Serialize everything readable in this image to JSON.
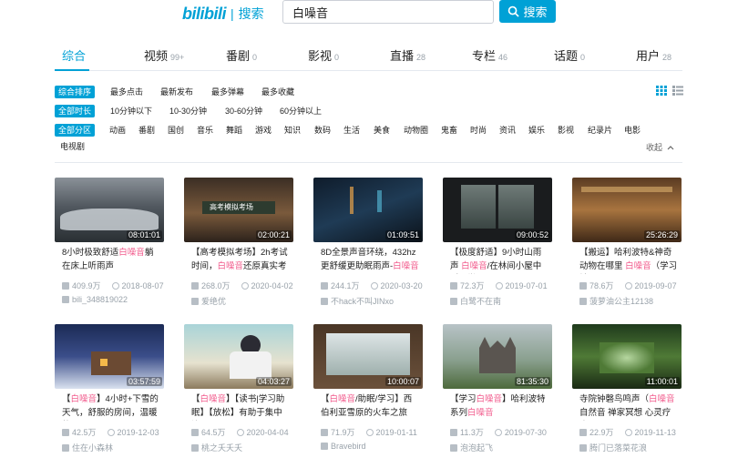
{
  "header": {
    "logo_mark": "bilibili",
    "logo_sep": "|",
    "logo_text": "搜索",
    "search_value": "白噪音",
    "search_button": "搜索"
  },
  "tabs": [
    {
      "label": "综合",
      "count": ""
    },
    {
      "label": "视频",
      "count": "99+"
    },
    {
      "label": "番剧",
      "count": "0"
    },
    {
      "label": "影视",
      "count": "0"
    },
    {
      "label": "直播",
      "count": "28"
    },
    {
      "label": "专栏",
      "count": "46"
    },
    {
      "label": "话题",
      "count": "0"
    },
    {
      "label": "用户",
      "count": "28"
    }
  ],
  "filters": {
    "order": [
      "综合排序",
      "最多点击",
      "最新发布",
      "最多弹幕",
      "最多收藏"
    ],
    "duration": [
      "全部时长",
      "10分钟以下",
      "10-30分钟",
      "30-60分钟",
      "60分钟以上"
    ],
    "zones": [
      "全部分区",
      "动画",
      "番剧",
      "国创",
      "音乐",
      "舞蹈",
      "游戏",
      "知识",
      "数码",
      "生活",
      "美食",
      "动物圈",
      "鬼畜",
      "时尚",
      "资讯",
      "娱乐",
      "影视",
      "纪录片",
      "电影",
      "电视剧"
    ],
    "collapse_label": "收起"
  },
  "videos": [
    {
      "duration": "08:01:01",
      "pre": "8小时极致舒适",
      "hl": "白噪音",
      "post": "躺在床上听雨声",
      "plays": "409.9万",
      "date": "2018-08-07",
      "uploader": "bili_348819022"
    },
    {
      "duration": "02:00:21",
      "pre": "【高考模拟考场】2h考试时间，",
      "hl": "白噪音",
      "post": "还原真实考场环",
      "plays": "268.0万",
      "date": "2020-04-02",
      "uploader": "爱绝优"
    },
    {
      "duration": "01:09:51",
      "pre": "8D全景声音环绕，432hz更舒缓更助眠雨声-",
      "hl": "白噪音",
      "post": "",
      "plays": "244.1万",
      "date": "2020-03-20",
      "uploader": "不hack不叫JINxo"
    },
    {
      "duration": "09:00:52",
      "pre": "【极度舒适】9小时山雨声 ",
      "hl": "白噪音",
      "post": "/在林间小屋中听雨学",
      "plays": "72.3万",
      "date": "2019-07-01",
      "uploader": "白鹭不在南"
    },
    {
      "duration": "25:26:29",
      "pre": "【搬运】哈利波特&神奇动物在哪里 ",
      "hl": "白噪音",
      "post": "（学习神",
      "plays": "78.6万",
      "date": "2019-09-07",
      "uploader": "菠萝油公主12138"
    },
    {
      "duration": "03:57:59",
      "pre": "【",
      "hl": "白噪音",
      "post": "】4小时+下雪的天气，舒服的房间，温暖的火",
      "plays": "42.5万",
      "date": "2019-12-03",
      "uploader": "住在小森林"
    },
    {
      "duration": "04:03:27",
      "pre": "【",
      "hl": "白噪音",
      "post": "】【读书|学习助眠】【放松】有助于集中注",
      "plays": "64.5万",
      "date": "2020-04-04",
      "uploader": "桃之夭夭夭"
    },
    {
      "duration": "10:00:07",
      "pre": "【",
      "hl": "白噪音",
      "post": "/助眠/学习】西伯利亚雪原的火车之旅",
      "plays": "71.9万",
      "date": "2019-01-11",
      "uploader": "Bravebird"
    },
    {
      "duration": "81:35:30",
      "pre": "【学习",
      "hl": "白噪音",
      "post": "】哈利波特系列",
      "hl2": "白噪音",
      "plays": "11.3万",
      "date": "2019-07-30",
      "uploader": "泡泡起飞"
    },
    {
      "duration": "11:00:01",
      "pre": "寺院钟磬鸟鸣声（",
      "hl": "白噪音",
      "post": " 自然音 禅家冥想 心灵疗愈)",
      "plays": "22.9万",
      "date": "2019-11-13",
      "uploader": "腾门已落菜花浪"
    }
  ],
  "colors": {
    "accent": "#00a1d6",
    "highlight": "#f25d8e",
    "muted": "#99a2aa"
  }
}
